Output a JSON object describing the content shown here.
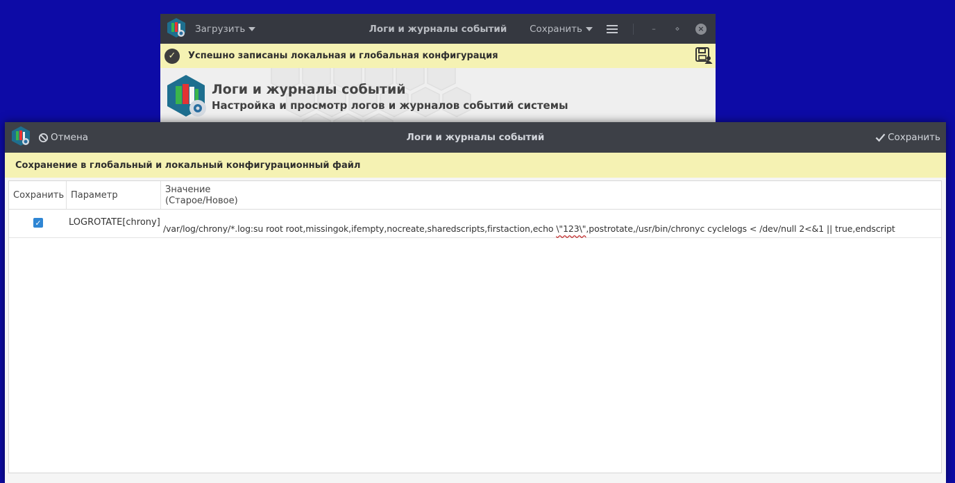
{
  "background_window": {
    "title": "Логи и журналы событий",
    "load_label": "Загрузить",
    "save_label": "Сохранить",
    "success_message": "Успешно записаны локальная и глобальная конфигурация",
    "banner_title": "Логи и журналы событий",
    "banner_subtitle": "Настройка и просмотр логов и журналов событий системы"
  },
  "dialog": {
    "title": "Логи и журналы событий",
    "cancel_label": "Отмена",
    "save_label": "Сохранить",
    "info_message": "Сохранение в глобальный и локальный конфигурационный файл",
    "table": {
      "headers": {
        "save": "Сохранить",
        "param": "Параметр",
        "value_line1": "Значение",
        "value_line2": "(Старое/Новое)"
      },
      "rows": [
        {
          "checked": true,
          "param": "LOGROTATE[chrony]",
          "value_before": "/var/log/chrony/*.log:su root root,missingok,ifempty,nocreate,sharedscripts,firstaction,echo ",
          "value_flagged": "\\\"123\\\"",
          "value_after": ",postrotate,/usr/bin/chronyc cyclelogs < /dev/null 2<&1 || true,endscript"
        }
      ]
    }
  },
  "colors": {
    "desktop": "#0d0ba6",
    "titlebar": "#353840",
    "notice_bar": "#f5f2b3",
    "checkbox": "#2f86d4",
    "spellcheck_underline": "#c02a2a"
  },
  "icons": {
    "app": "logs-app-icon",
    "cancel": "prohibit-icon",
    "save": "checkmark-icon",
    "success": "check-circle-icon",
    "disk": "save-disk-user-icon",
    "menu": "hamburger-menu-icon"
  }
}
